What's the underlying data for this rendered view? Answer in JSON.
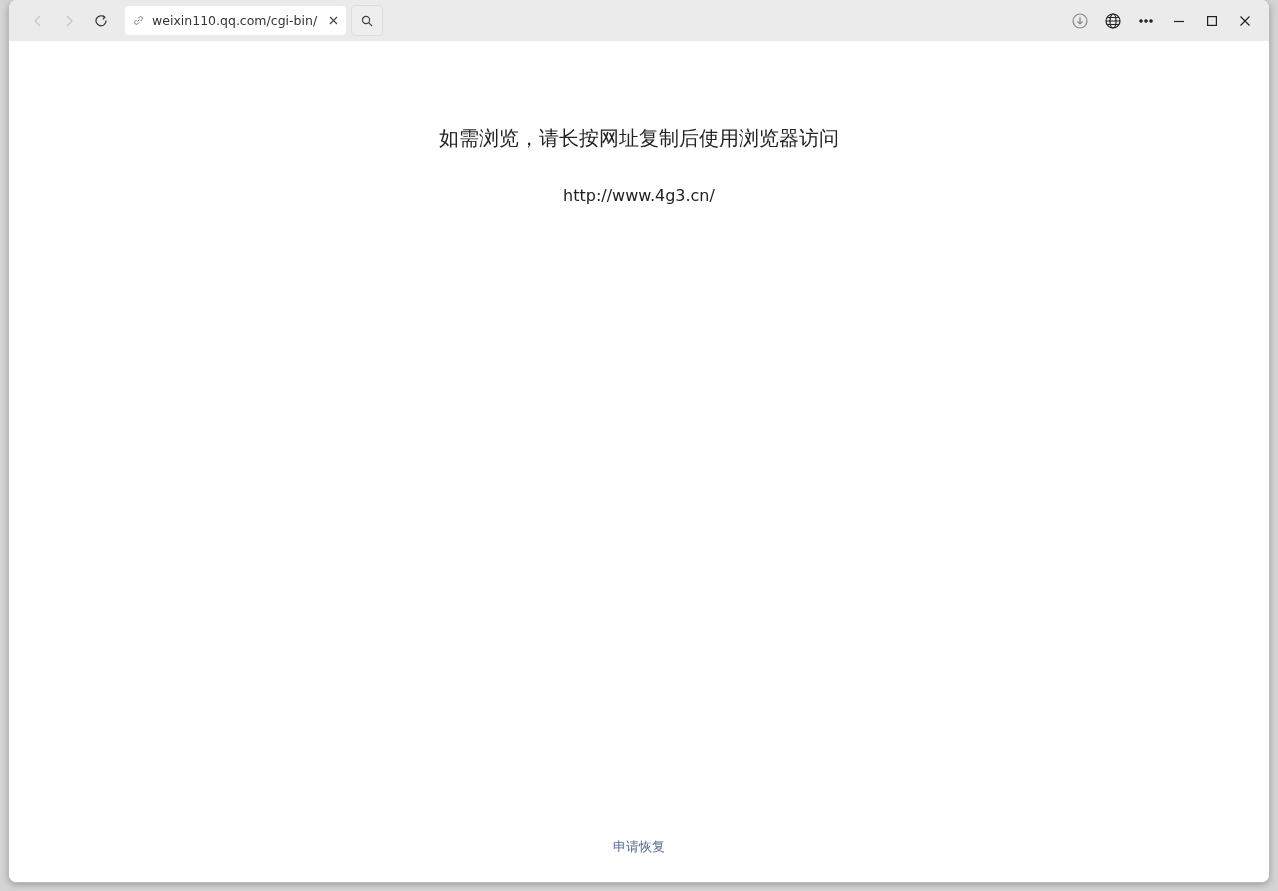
{
  "toolbar": {
    "back": {
      "disabled": true
    },
    "forward": {
      "disabled": true
    },
    "address": "weixin110.qq.com/cgi-bin/"
  },
  "page": {
    "message": "如需浏览，请长按网址复制后使用浏览器访问",
    "url": "http://www.4g3.cn/",
    "link": "申请恢复"
  }
}
